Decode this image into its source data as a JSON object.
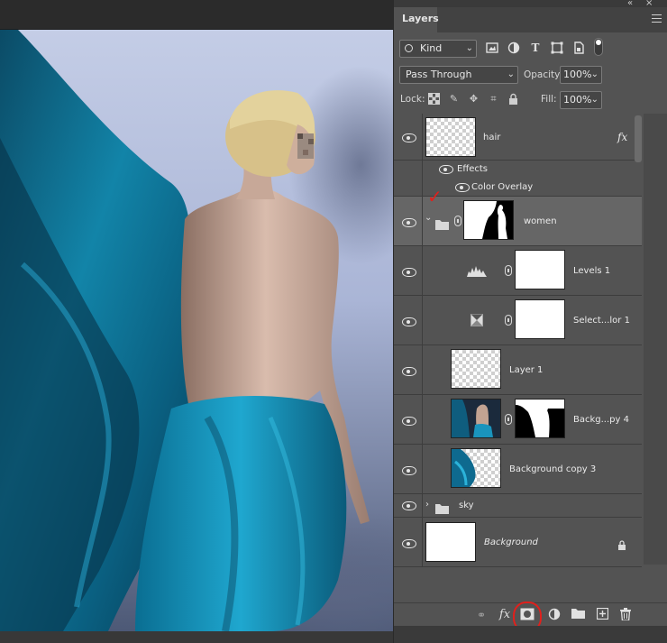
{
  "panel": {
    "tab_label": "Layers"
  },
  "filter": {
    "kind_label": "Kind",
    "icons": [
      "image-filter-icon",
      "adjustment-filter-icon",
      "type-filter-icon",
      "shape-filter-icon",
      "smart-object-filter-icon",
      "filter-toggle-icon"
    ]
  },
  "blend": {
    "mode": "Pass Through",
    "opacity_label": "Opacity:",
    "opacity_value": "100%",
    "lock_label": "Lock:",
    "fill_label": "Fill:",
    "fill_value": "100%"
  },
  "layers": {
    "hair": {
      "name": "hair",
      "effects_label": "Effects",
      "effect_1": "Color Overlay",
      "fx_badge": "fx"
    },
    "women": {
      "name": "women",
      "annotation": "✓"
    },
    "levels": {
      "name": "Levels 1"
    },
    "selective_color": {
      "name": "Select...lor 1"
    },
    "layer1": {
      "name": "Layer 1"
    },
    "bg_copy4": {
      "name": "Backg...py 4"
    },
    "bg_copy3": {
      "name": "Background copy 3"
    },
    "sky": {
      "name": "sky"
    },
    "background": {
      "name": "Background"
    }
  },
  "bottom_bar": {
    "fx_label": "fx"
  },
  "colors": {
    "panel_bg": "#535353",
    "selected_row": "#666666",
    "annotation_red": "#e0201c"
  }
}
